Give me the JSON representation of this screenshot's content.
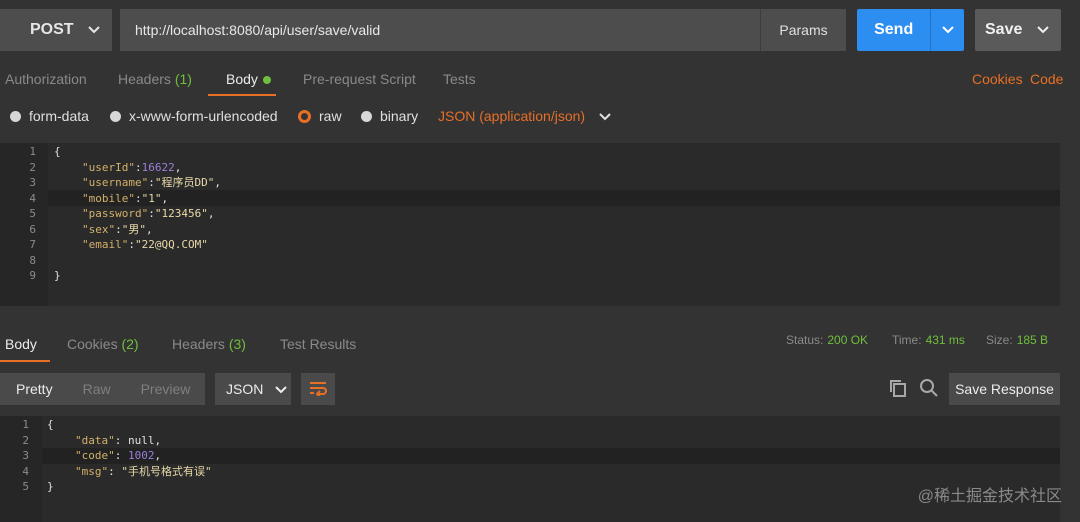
{
  "request": {
    "method": "POST",
    "url": "http://localhost:8080/api/user/save/valid",
    "params_label": "Params",
    "send_label": "Send",
    "save_label": "Save"
  },
  "request_tabs": {
    "authorization": "Authorization",
    "headers": "Headers",
    "headers_count": "(1)",
    "body": "Body",
    "prerequest": "Pre-request Script",
    "tests": "Tests",
    "cookies": "Cookies",
    "code": "Code"
  },
  "body_types": {
    "form_data": "form-data",
    "urlencoded": "x-www-form-urlencoded",
    "raw": "raw",
    "binary": "binary",
    "content_type": "JSON (application/json)"
  },
  "request_body": {
    "line_numbers": [
      "1",
      "2",
      "3",
      "4",
      "5",
      "6",
      "7",
      "8",
      "9"
    ],
    "open": "{",
    "close": "}",
    "fields": [
      {
        "key": "\"userId\"",
        "sep": ":",
        "value": "16622",
        "tail": ",",
        "kind": "num"
      },
      {
        "key": "\"username\"",
        "sep": ":",
        "value": "\"程序员DD\"",
        "tail": ",",
        "kind": "str"
      },
      {
        "key": "\"mobile\"",
        "sep": ":",
        "value": "\"1\"",
        "tail": ",",
        "kind": "str"
      },
      {
        "key": "\"password\"",
        "sep": ":",
        "value": "\"123456\"",
        "tail": ",",
        "kind": "str"
      },
      {
        "key": "\"sex\"",
        "sep": ":",
        "value": "\"男\"",
        "tail": ",",
        "kind": "str"
      },
      {
        "key": "\"email\"",
        "sep": ":",
        "value": "\"22@QQ.COM\"",
        "tail": "",
        "kind": "str"
      }
    ]
  },
  "response_tabs": {
    "body": "Body",
    "cookies": "Cookies",
    "cookies_count": "(2)",
    "headers": "Headers",
    "headers_count": "(3)",
    "test_results": "Test Results"
  },
  "response_status": {
    "status_label": "Status:",
    "status_value": "200 OK",
    "time_label": "Time:",
    "time_value": "431 ms",
    "size_label": "Size:",
    "size_value": "185 B"
  },
  "response_toolbar": {
    "pretty": "Pretty",
    "raw": "Raw",
    "preview": "Preview",
    "format": "JSON",
    "save_response": "Save Response"
  },
  "response_body": {
    "line_numbers": [
      "1",
      "2",
      "3",
      "4",
      "5"
    ],
    "open": "{",
    "close": "}",
    "fields": [
      {
        "key": "\"data\"",
        "sep": ": ",
        "value": "null",
        "tail": ",",
        "kind": "plain"
      },
      {
        "key": "\"code\"",
        "sep": ": ",
        "value": "1002",
        "tail": ",",
        "kind": "num"
      },
      {
        "key": "\"msg\"",
        "sep": ": ",
        "value": "\"手机号格式有误\"",
        "tail": "",
        "kind": "str"
      }
    ]
  },
  "watermark": "@稀土掘金技术社区",
  "colors": {
    "accent_orange": "#e76f26",
    "send_blue": "#2c8ef0",
    "count_green": "#6fbf3d",
    "number_purple": "#9a7fd9",
    "key_gold": "#d4b06a"
  },
  "icons": [
    "chevron-down-icon",
    "wrap-lines-icon",
    "copy-icon",
    "search-icon"
  ]
}
